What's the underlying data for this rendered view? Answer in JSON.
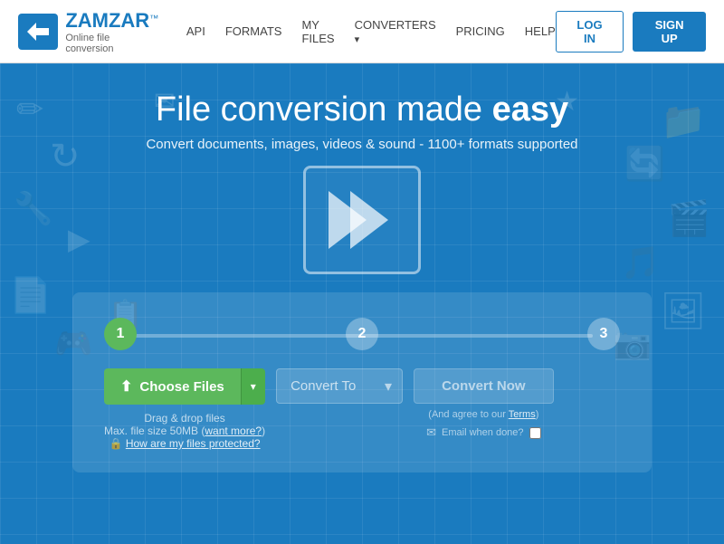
{
  "navbar": {
    "logo_name": "ZAMZAR",
    "logo_tm": "™",
    "logo_sub": "Online file conversion",
    "nav_links": [
      {
        "id": "api",
        "label": "API",
        "has_arrow": false
      },
      {
        "id": "formats",
        "label": "FORMATS",
        "has_arrow": false
      },
      {
        "id": "myfiles",
        "label": "MY FILES",
        "has_arrow": false
      },
      {
        "id": "converters",
        "label": "CONVERTERS",
        "has_arrow": true
      },
      {
        "id": "pricing",
        "label": "PRICING",
        "has_arrow": false
      },
      {
        "id": "help",
        "label": "HELP",
        "has_arrow": false
      }
    ],
    "login_label": "LOG IN",
    "signup_label": "SIGN UP"
  },
  "hero": {
    "title_normal": "File conversion made",
    "title_bold": "easy",
    "subtitle": "Convert documents, images, videos & sound - 1100+ formats supported"
  },
  "converter": {
    "step1_label": "1",
    "step2_label": "2",
    "step3_label": "3",
    "choose_files_label": "Choose Files",
    "convert_to_label": "Convert To",
    "convert_now_label": "Convert Now",
    "drag_drop_label": "Drag & drop files",
    "file_size_label": "Max. file size 50MB (",
    "want_more_label": "want more?",
    "file_size_end": ")",
    "protection_label": "How are my files protected?",
    "terms_label": "(And agree to our ",
    "terms_link": "Terms",
    "terms_end": ")",
    "email_label": "Email when done?",
    "upload_icon": "⬆"
  },
  "colors": {
    "primary": "#1a7bbf",
    "green": "#5cb85c",
    "green_dark": "#4cae4c"
  }
}
